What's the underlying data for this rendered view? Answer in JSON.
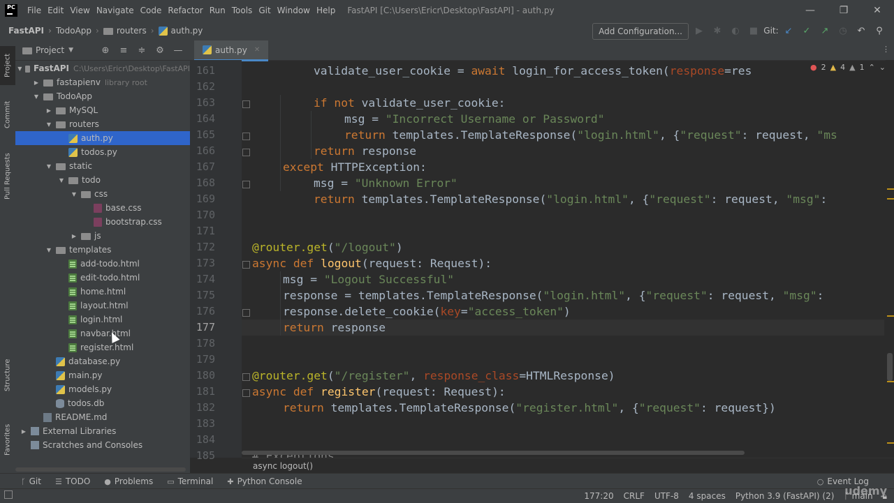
{
  "menu": {
    "logo": "PC",
    "items": [
      "File",
      "Edit",
      "View",
      "Navigate",
      "Code",
      "Refactor",
      "Run",
      "Tools",
      "Git",
      "Window",
      "Help"
    ],
    "window_title": "FastAPI [C:\\Users\\Ericr\\Desktop\\FastAPI] - auth.py"
  },
  "navbar": {
    "crumbs": [
      "FastAPI",
      "TodoApp",
      "routers",
      "auth.py"
    ],
    "add_configuration": "Add Configuration...",
    "git_label": "Git:"
  },
  "left_stripe": {
    "project": "Project",
    "commit": "Commit",
    "pull_requests": "Pull Requests",
    "structure": "Structure",
    "favorites": "Favorites"
  },
  "project_panel": {
    "title": "Project",
    "tree": [
      {
        "label": "FastAPI",
        "hint": "C:\\Users\\Ericr\\Desktop\\FastAPI",
        "kind": "folder",
        "depth": 0,
        "open": true
      },
      {
        "label": "fastapienv",
        "hint": "library root",
        "kind": "folder",
        "depth": 1,
        "open": false
      },
      {
        "label": "TodoApp",
        "hint": "",
        "kind": "folder",
        "depth": 1,
        "open": true
      },
      {
        "label": "MySQL",
        "hint": "",
        "kind": "folder",
        "depth": 2,
        "open": false
      },
      {
        "label": "routers",
        "hint": "",
        "kind": "folder",
        "depth": 2,
        "open": true
      },
      {
        "label": "auth.py",
        "hint": "",
        "kind": "py",
        "depth": 3,
        "selected": true
      },
      {
        "label": "todos.py",
        "hint": "",
        "kind": "py",
        "depth": 3
      },
      {
        "label": "static",
        "hint": "",
        "kind": "folder",
        "depth": 2,
        "open": true
      },
      {
        "label": "todo",
        "hint": "",
        "kind": "folder",
        "depth": 3,
        "open": true
      },
      {
        "label": "css",
        "hint": "",
        "kind": "folder",
        "depth": 4,
        "open": true
      },
      {
        "label": "base.css",
        "hint": "",
        "kind": "css",
        "depth": 5
      },
      {
        "label": "bootstrap.css",
        "hint": "",
        "kind": "css",
        "depth": 5
      },
      {
        "label": "js",
        "hint": "",
        "kind": "folder",
        "depth": 4,
        "open": false
      },
      {
        "label": "templates",
        "hint": "",
        "kind": "folder",
        "depth": 2,
        "open": true
      },
      {
        "label": "add-todo.html",
        "hint": "",
        "kind": "html",
        "depth": 3
      },
      {
        "label": "edit-todo.html",
        "hint": "",
        "kind": "html",
        "depth": 3
      },
      {
        "label": "home.html",
        "hint": "",
        "kind": "html",
        "depth": 3
      },
      {
        "label": "layout.html",
        "hint": "",
        "kind": "html",
        "depth": 3
      },
      {
        "label": "login.html",
        "hint": "",
        "kind": "html",
        "depth": 3
      },
      {
        "label": "navbar.html",
        "hint": "",
        "kind": "html",
        "depth": 3
      },
      {
        "label": "register.html",
        "hint": "",
        "kind": "html",
        "depth": 3
      },
      {
        "label": "database.py",
        "hint": "",
        "kind": "py",
        "depth": 2
      },
      {
        "label": "main.py",
        "hint": "",
        "kind": "py",
        "depth": 2
      },
      {
        "label": "models.py",
        "hint": "",
        "kind": "py",
        "depth": 2
      },
      {
        "label": "todos.db",
        "hint": "",
        "kind": "db",
        "depth": 2
      },
      {
        "label": "README.md",
        "hint": "",
        "kind": "md",
        "depth": 1
      },
      {
        "label": "External Libraries",
        "hint": "",
        "kind": "lib",
        "depth": 0,
        "open": false
      },
      {
        "label": "Scratches and Consoles",
        "hint": "",
        "kind": "lib",
        "depth": 0
      }
    ]
  },
  "editor": {
    "tab": "auth.py",
    "current_line": "177",
    "inspections": {
      "errors": "2",
      "warnings": "4",
      "weak": "1"
    },
    "lines": [
      {
        "n": "161",
        "indent": 4,
        "toks": [
          [
            "",
            "validate_user_cookie = "
          ],
          [
            "kw",
            "await "
          ],
          [
            "",
            "login_for_access_token("
          ],
          [
            "param",
            "response"
          ],
          [
            "",
            "=res"
          ]
        ]
      },
      {
        "n": "162",
        "indent": 0,
        "toks": []
      },
      {
        "n": "163",
        "indent": 4,
        "toks": [
          [
            "kw",
            "if not "
          ],
          [
            "",
            "validate_user_cookie:"
          ]
        ]
      },
      {
        "n": "164",
        "indent": 6,
        "toks": [
          [
            "",
            "msg = "
          ],
          [
            "str",
            "\"Incorrect Username or Password\""
          ]
        ]
      },
      {
        "n": "165",
        "indent": 6,
        "toks": [
          [
            "kw",
            "return "
          ],
          [
            "",
            "templates.TemplateResponse("
          ],
          [
            "str",
            "\"login.html\""
          ],
          [
            "",
            ", {"
          ],
          [
            "str",
            "\"request\""
          ],
          [
            "",
            ": request, "
          ],
          [
            "str",
            "\"ms"
          ]
        ]
      },
      {
        "n": "166",
        "indent": 4,
        "toks": [
          [
            "kw",
            "return "
          ],
          [
            "",
            "response"
          ]
        ]
      },
      {
        "n": "167",
        "indent": 2,
        "toks": [
          [
            "kw",
            "except "
          ],
          [
            "",
            "HTTPException:"
          ]
        ]
      },
      {
        "n": "168",
        "indent": 4,
        "toks": [
          [
            "",
            "msg = "
          ],
          [
            "str",
            "\"Unknown Error\""
          ]
        ]
      },
      {
        "n": "169",
        "indent": 4,
        "toks": [
          [
            "kw",
            "return "
          ],
          [
            "",
            "templates.TemplateResponse("
          ],
          [
            "str",
            "\"login.html\""
          ],
          [
            "",
            ", {"
          ],
          [
            "str",
            "\"request\""
          ],
          [
            "",
            ": request, "
          ],
          [
            "str",
            "\"msg\""
          ],
          [
            "",
            ":"
          ]
        ]
      },
      {
        "n": "170",
        "indent": 0,
        "toks": []
      },
      {
        "n": "171",
        "indent": 0,
        "toks": []
      },
      {
        "n": "172",
        "indent": 0,
        "toks": [
          [
            "dec",
            "@router.get"
          ],
          [
            "",
            "("
          ],
          [
            "str",
            "\"/logout\""
          ],
          [
            "",
            ")"
          ]
        ]
      },
      {
        "n": "173",
        "indent": 0,
        "toks": [
          [
            "kw",
            "async def "
          ],
          [
            "fn",
            "logout"
          ],
          [
            "",
            "(request: Request):"
          ]
        ]
      },
      {
        "n": "174",
        "indent": 2,
        "toks": [
          [
            "",
            "msg = "
          ],
          [
            "str",
            "\"Logout Successful\""
          ]
        ]
      },
      {
        "n": "175",
        "indent": 2,
        "toks": [
          [
            "",
            "response = templates.TemplateResponse("
          ],
          [
            "str",
            "\"login.html\""
          ],
          [
            "",
            ", {"
          ],
          [
            "str",
            "\"request\""
          ],
          [
            "",
            ": request, "
          ],
          [
            "str",
            "\"msg\""
          ],
          [
            "",
            ":"
          ]
        ]
      },
      {
        "n": "176",
        "indent": 2,
        "toks": [
          [
            "",
            "response.delete_cookie("
          ],
          [
            "param",
            "key"
          ],
          [
            "",
            "="
          ],
          [
            "str",
            "\"access_token\""
          ],
          [
            "",
            ")"
          ]
        ]
      },
      {
        "n": "177",
        "indent": 2,
        "toks": [
          [
            "kw",
            "return "
          ],
          [
            "",
            "response"
          ]
        ]
      },
      {
        "n": "178",
        "indent": 0,
        "toks": []
      },
      {
        "n": "179",
        "indent": 0,
        "toks": []
      },
      {
        "n": "180",
        "indent": 0,
        "toks": [
          [
            "dec",
            "@router.get"
          ],
          [
            "",
            "("
          ],
          [
            "str",
            "\"/register\""
          ],
          [
            "",
            ", "
          ],
          [
            "param",
            "response_class"
          ],
          [
            "",
            "=HTMLResponse)"
          ]
        ]
      },
      {
        "n": "181",
        "indent": 0,
        "toks": [
          [
            "kw",
            "async def "
          ],
          [
            "fn",
            "register"
          ],
          [
            "",
            "(request: Request):"
          ]
        ]
      },
      {
        "n": "182",
        "indent": 2,
        "toks": [
          [
            "kw",
            "return "
          ],
          [
            "",
            "templates.TemplateResponse("
          ],
          [
            "str",
            "\"register.html\""
          ],
          [
            "",
            ", {"
          ],
          [
            "str",
            "\"request\""
          ],
          [
            "",
            ": request})"
          ]
        ]
      },
      {
        "n": "183",
        "indent": 0,
        "toks": []
      },
      {
        "n": "184",
        "indent": 0,
        "toks": []
      },
      {
        "n": "185",
        "indent": 0,
        "toks": [
          [
            "",
            "# Exceptions"
          ]
        ]
      }
    ],
    "breadcrumb": "async logout()"
  },
  "bottom_tools": [
    "Git",
    "TODO",
    "Problems",
    "Terminal",
    "Python Console"
  ],
  "event_log": "Event Log",
  "status": {
    "position": "177:20",
    "line_sep": "CRLF",
    "encoding": "UTF-8",
    "indent": "4 spaces",
    "interpreter": "Python 3.9 (FastAPI) (2)",
    "branch": "main"
  },
  "watermark": "udemy",
  "colors": {
    "accent": "#2f65ca",
    "keyword": "#cc7832",
    "string": "#6a8759",
    "function": "#ffc66d",
    "decorator": "#bbb529",
    "param": "#aa4926"
  }
}
